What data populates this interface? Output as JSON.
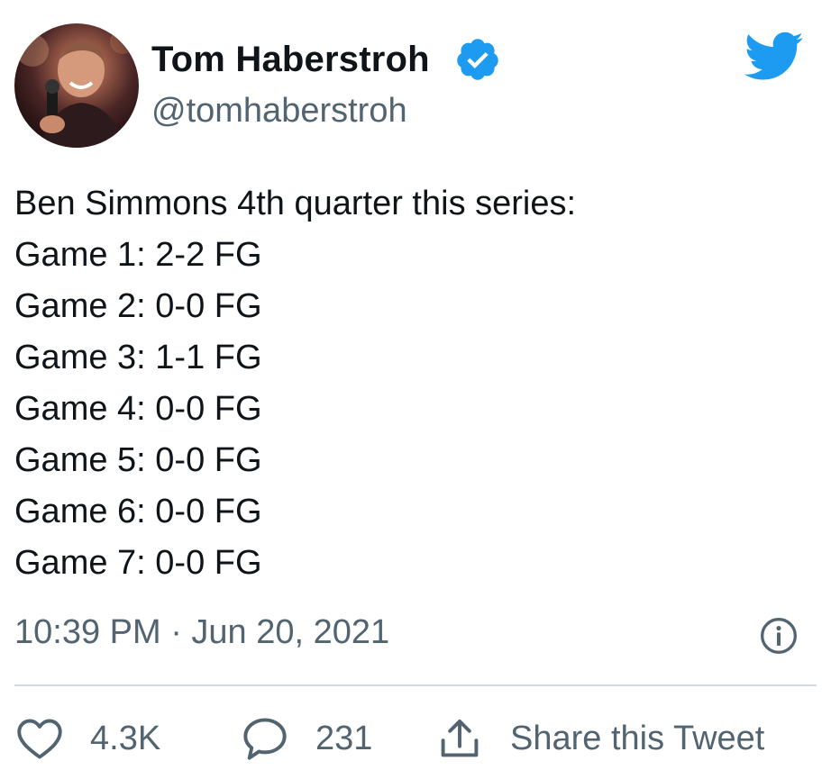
{
  "header": {
    "display_name": "Tom Haberstroh",
    "handle": "@tomhaberstroh",
    "verified": true,
    "logo": "twitter-bird-icon"
  },
  "tweet": {
    "lines": [
      "Ben Simmons 4th quarter this series:",
      "Game 1: 2-2 FG",
      "Game 2: 0-0 FG",
      "Game 3: 1-1 FG",
      "Game 4: 0-0 FG",
      "Game 5: 0-0 FG",
      "Game 6: 0-0 FG",
      "Game 7: 0-0 FG"
    ],
    "timestamp": "10:39 PM · Jun 20, 2021"
  },
  "actions": {
    "likes": "4.3K",
    "replies": "231",
    "share_label": "Share this Tweet"
  },
  "colors": {
    "text": "#0f1419",
    "secondary": "#536471",
    "twitter_blue": "#1d9bf0",
    "divider": "#cfd9de"
  },
  "icons": [
    "verified-badge-icon",
    "twitter-bird-icon",
    "info-icon",
    "heart-icon",
    "reply-bubble-icon",
    "share-icon"
  ]
}
